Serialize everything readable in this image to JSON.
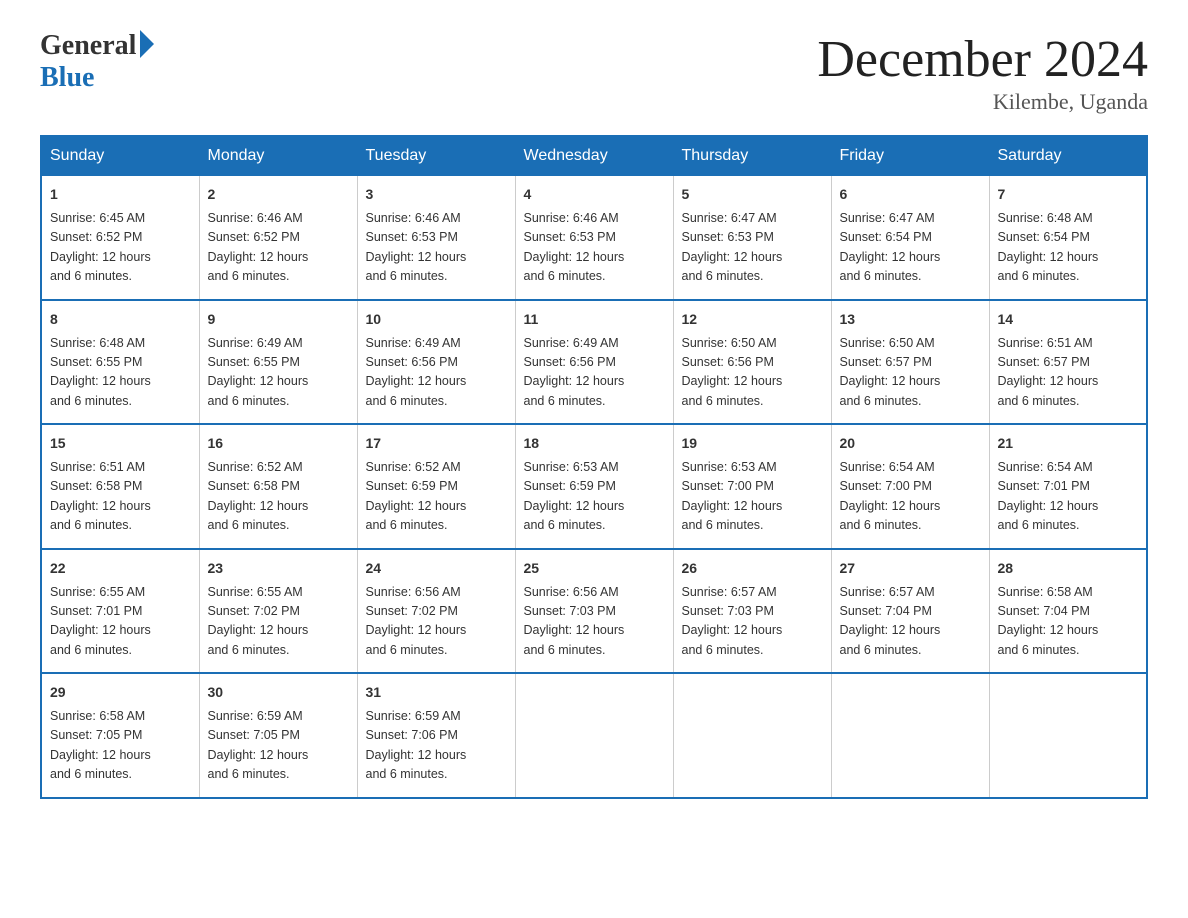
{
  "header": {
    "logo_general": "General",
    "logo_blue": "Blue",
    "title": "December 2024",
    "location": "Kilembe, Uganda"
  },
  "days_of_week": [
    "Sunday",
    "Monday",
    "Tuesday",
    "Wednesday",
    "Thursday",
    "Friday",
    "Saturday"
  ],
  "weeks": [
    [
      {
        "day": "1",
        "sunrise": "6:45 AM",
        "sunset": "6:52 PM",
        "daylight": "12 hours and 6 minutes."
      },
      {
        "day": "2",
        "sunrise": "6:46 AM",
        "sunset": "6:52 PM",
        "daylight": "12 hours and 6 minutes."
      },
      {
        "day": "3",
        "sunrise": "6:46 AM",
        "sunset": "6:53 PM",
        "daylight": "12 hours and 6 minutes."
      },
      {
        "day": "4",
        "sunrise": "6:46 AM",
        "sunset": "6:53 PM",
        "daylight": "12 hours and 6 minutes."
      },
      {
        "day": "5",
        "sunrise": "6:47 AM",
        "sunset": "6:53 PM",
        "daylight": "12 hours and 6 minutes."
      },
      {
        "day": "6",
        "sunrise": "6:47 AM",
        "sunset": "6:54 PM",
        "daylight": "12 hours and 6 minutes."
      },
      {
        "day": "7",
        "sunrise": "6:48 AM",
        "sunset": "6:54 PM",
        "daylight": "12 hours and 6 minutes."
      }
    ],
    [
      {
        "day": "8",
        "sunrise": "6:48 AM",
        "sunset": "6:55 PM",
        "daylight": "12 hours and 6 minutes."
      },
      {
        "day": "9",
        "sunrise": "6:49 AM",
        "sunset": "6:55 PM",
        "daylight": "12 hours and 6 minutes."
      },
      {
        "day": "10",
        "sunrise": "6:49 AM",
        "sunset": "6:56 PM",
        "daylight": "12 hours and 6 minutes."
      },
      {
        "day": "11",
        "sunrise": "6:49 AM",
        "sunset": "6:56 PM",
        "daylight": "12 hours and 6 minutes."
      },
      {
        "day": "12",
        "sunrise": "6:50 AM",
        "sunset": "6:56 PM",
        "daylight": "12 hours and 6 minutes."
      },
      {
        "day": "13",
        "sunrise": "6:50 AM",
        "sunset": "6:57 PM",
        "daylight": "12 hours and 6 minutes."
      },
      {
        "day": "14",
        "sunrise": "6:51 AM",
        "sunset": "6:57 PM",
        "daylight": "12 hours and 6 minutes."
      }
    ],
    [
      {
        "day": "15",
        "sunrise": "6:51 AM",
        "sunset": "6:58 PM",
        "daylight": "12 hours and 6 minutes."
      },
      {
        "day": "16",
        "sunrise": "6:52 AM",
        "sunset": "6:58 PM",
        "daylight": "12 hours and 6 minutes."
      },
      {
        "day": "17",
        "sunrise": "6:52 AM",
        "sunset": "6:59 PM",
        "daylight": "12 hours and 6 minutes."
      },
      {
        "day": "18",
        "sunrise": "6:53 AM",
        "sunset": "6:59 PM",
        "daylight": "12 hours and 6 minutes."
      },
      {
        "day": "19",
        "sunrise": "6:53 AM",
        "sunset": "7:00 PM",
        "daylight": "12 hours and 6 minutes."
      },
      {
        "day": "20",
        "sunrise": "6:54 AM",
        "sunset": "7:00 PM",
        "daylight": "12 hours and 6 minutes."
      },
      {
        "day": "21",
        "sunrise": "6:54 AM",
        "sunset": "7:01 PM",
        "daylight": "12 hours and 6 minutes."
      }
    ],
    [
      {
        "day": "22",
        "sunrise": "6:55 AM",
        "sunset": "7:01 PM",
        "daylight": "12 hours and 6 minutes."
      },
      {
        "day": "23",
        "sunrise": "6:55 AM",
        "sunset": "7:02 PM",
        "daylight": "12 hours and 6 minutes."
      },
      {
        "day": "24",
        "sunrise": "6:56 AM",
        "sunset": "7:02 PM",
        "daylight": "12 hours and 6 minutes."
      },
      {
        "day": "25",
        "sunrise": "6:56 AM",
        "sunset": "7:03 PM",
        "daylight": "12 hours and 6 minutes."
      },
      {
        "day": "26",
        "sunrise": "6:57 AM",
        "sunset": "7:03 PM",
        "daylight": "12 hours and 6 minutes."
      },
      {
        "day": "27",
        "sunrise": "6:57 AM",
        "sunset": "7:04 PM",
        "daylight": "12 hours and 6 minutes."
      },
      {
        "day": "28",
        "sunrise": "6:58 AM",
        "sunset": "7:04 PM",
        "daylight": "12 hours and 6 minutes."
      }
    ],
    [
      {
        "day": "29",
        "sunrise": "6:58 AM",
        "sunset": "7:05 PM",
        "daylight": "12 hours and 6 minutes."
      },
      {
        "day": "30",
        "sunrise": "6:59 AM",
        "sunset": "7:05 PM",
        "daylight": "12 hours and 6 minutes."
      },
      {
        "day": "31",
        "sunrise": "6:59 AM",
        "sunset": "7:06 PM",
        "daylight": "12 hours and 6 minutes."
      },
      null,
      null,
      null,
      null
    ]
  ],
  "labels": {
    "sunrise": "Sunrise:",
    "sunset": "Sunset:",
    "daylight": "Daylight:"
  }
}
